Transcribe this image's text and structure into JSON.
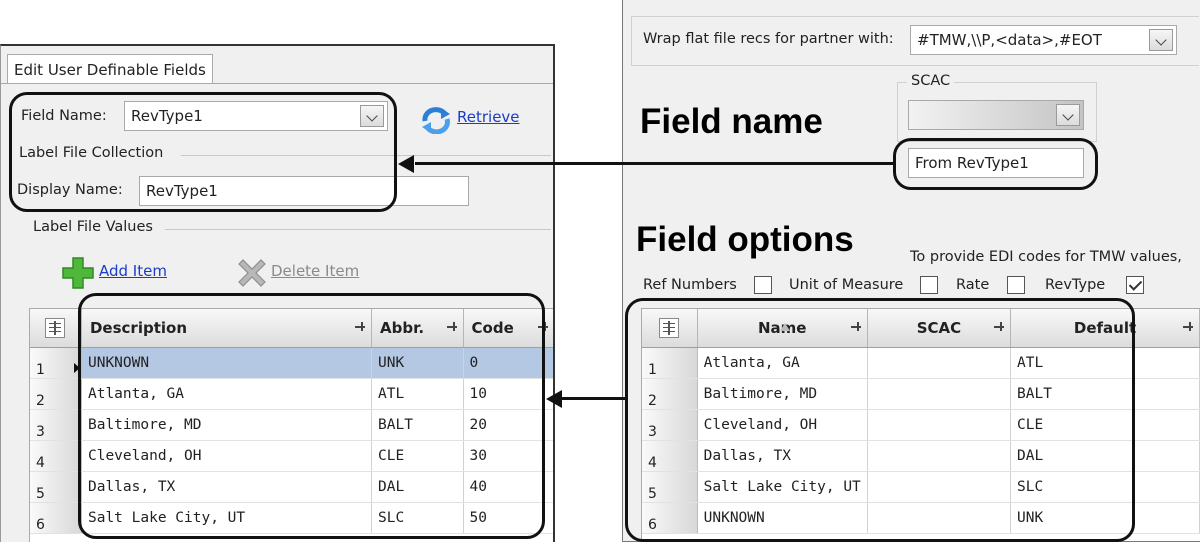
{
  "left_panel": {
    "tab_label": "Edit User Definable Fields",
    "field_name_label": "Field Name:",
    "field_name_value": "RevType1",
    "retrieve_label": "Retrieve",
    "label_file_collection": "Label File Collection",
    "display_name_label": "Display Name:",
    "display_name_value": "RevType1",
    "label_file_values": "Label File Values",
    "add_item_label": "Add Item",
    "delete_item_label": "Delete Item",
    "grid": {
      "columns": [
        "Description",
        "Abbr.",
        "Code"
      ],
      "rows": [
        {
          "num": "1",
          "description": "UNKNOWN",
          "abbr": "UNK",
          "code": "0"
        },
        {
          "num": "2",
          "description": "Atlanta, GA",
          "abbr": "ATL",
          "code": "10"
        },
        {
          "num": "3",
          "description": "Baltimore, MD",
          "abbr": "BALT",
          "code": "20"
        },
        {
          "num": "4",
          "description": "Cleveland, OH",
          "abbr": "CLE",
          "code": "30"
        },
        {
          "num": "5",
          "description": "Dallas, TX",
          "abbr": "DAL",
          "code": "40"
        },
        {
          "num": "6",
          "description": "Salt Lake City, UT",
          "abbr": "SLC",
          "code": "50"
        }
      ]
    }
  },
  "right_panel": {
    "wrap_label": "Wrap flat file recs for partner with:",
    "wrap_value": "#TMW,\\\\P,<data>,#EOT",
    "scac_label": "SCAC",
    "from_field_value": "From RevType1",
    "edi_note": "To provide EDI codes for TMW values,",
    "checkboxes": [
      {
        "label": "Ref Numbers",
        "checked": false
      },
      {
        "label": "Unit of Measure",
        "checked": false
      },
      {
        "label": "Rate",
        "checked": false
      },
      {
        "label": "RevType",
        "checked": true
      }
    ],
    "grid": {
      "columns": [
        "Name",
        "SCAC",
        "Default"
      ],
      "rows": [
        {
          "num": "1",
          "name": "Atlanta, GA",
          "scac": "",
          "default": "ATL"
        },
        {
          "num": "2",
          "name": "Baltimore, MD",
          "scac": "",
          "default": "BALT"
        },
        {
          "num": "3",
          "name": "Cleveland, OH",
          "scac": "",
          "default": "CLE"
        },
        {
          "num": "4",
          "name": "Dallas, TX",
          "scac": "",
          "default": "DAL"
        },
        {
          "num": "5",
          "name": "Salt Lake City, UT",
          "scac": "",
          "default": "SLC"
        },
        {
          "num": "6",
          "name": "UNKNOWN",
          "scac": "",
          "default": "UNK"
        }
      ]
    }
  },
  "annotations": {
    "field_name_heading": "Field name",
    "field_options_heading": "Field options"
  },
  "icons": {
    "retrieve": "refresh-icon",
    "add_item": "green-plus-icon",
    "delete_item": "gray-x-icon",
    "dropdown": "chevron-down-icon",
    "grid_corner": "column-chooser-icon",
    "column_pin": "pin-icon"
  }
}
